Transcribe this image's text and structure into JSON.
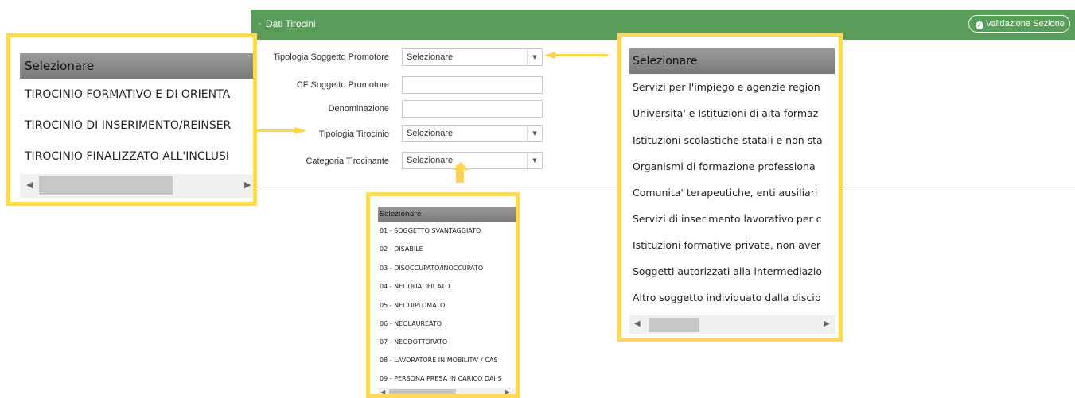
{
  "header": {
    "title": "Dati Tirocini",
    "validate_label": "Validazione Sezione",
    "accent_color": "#5a9c5a"
  },
  "form": {
    "fields": [
      {
        "label": "Tipologia Soggetto Promotore",
        "type": "select",
        "value": "Selezionare"
      },
      {
        "label": "CF Soggetto Promotore",
        "type": "text",
        "value": ""
      },
      {
        "label": "Denominazione",
        "type": "text",
        "value": ""
      },
      {
        "label": "Tipologia Tirocinio",
        "type": "select",
        "value": "Selezionare"
      },
      {
        "label": "Categoria Tirocinante",
        "type": "select",
        "value": "Selezionare"
      }
    ]
  },
  "dropdown_tipologia_tirocinio": {
    "header": "Selezionare",
    "items": [
      "TIROCINIO FORMATIVO E DI ORIENTA",
      "TIROCINIO DI INSERIMENTO/REINSER",
      "TIROCINIO FINALIZZATO ALL'INCLUSI"
    ]
  },
  "dropdown_categoria": {
    "header": "Selezionare",
    "items": [
      "01 - SOGGETTO SVANTAGGIATO",
      "02 - DISABILE",
      "03 - DISOCCUPATO/INOCCUPATO",
      "04 - NEOQUALIFICATO",
      "05 - NEODIPLOMATO",
      "06 - NEOLAUREATO",
      "07 - NEODOTTORATO",
      "08 - LAVORATORE IN MOBILITA' / CAS",
      "09 - PERSONA PRESA IN CARICO DAI S"
    ]
  },
  "dropdown_soggetto_promotore": {
    "header": "Selezionare",
    "items": [
      "Servizi per l'impiego e agenzie region",
      "Universita' e Istituzioni di alta formaz",
      "Istituzioni scolastiche statali e non sta",
      "Organismi di formazione professiona",
      "Comunita' terapeutiche, enti ausiliari",
      "Servizi di inserimento lavorativo per c",
      "Istituzioni formative private, non aver",
      "Soggetti autorizzati alla intermediazio",
      "Altro soggetto individuato dalla discip"
    ]
  },
  "callout_color": "#ffd85c"
}
